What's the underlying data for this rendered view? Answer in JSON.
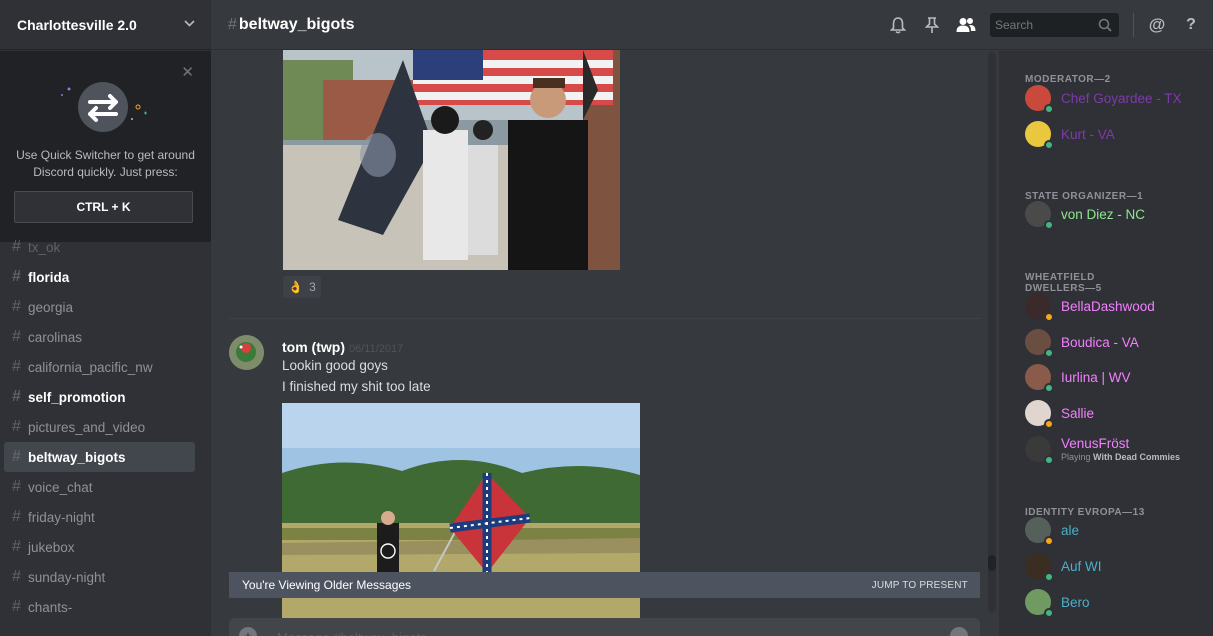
{
  "server": {
    "name": "Charlottesville 2.0"
  },
  "quick_switcher": {
    "text": "Use Quick Switcher to get around Discord quickly. Just press:",
    "key": "CTRL + K"
  },
  "channels": [
    {
      "name": "tx_ok",
      "state": "muted"
    },
    {
      "name": "florida",
      "state": "unread"
    },
    {
      "name": "georgia",
      "state": "normal"
    },
    {
      "name": "carolinas",
      "state": "normal"
    },
    {
      "name": "california_pacific_nw",
      "state": "normal"
    },
    {
      "name": "self_promotion",
      "state": "unread"
    },
    {
      "name": "pictures_and_video",
      "state": "normal"
    },
    {
      "name": "beltway_bigots",
      "state": "active"
    },
    {
      "name": "voice_chat",
      "state": "normal"
    },
    {
      "name": "friday-night",
      "state": "normal"
    },
    {
      "name": "jukebox",
      "state": "normal"
    },
    {
      "name": "sunday-night",
      "state": "normal"
    },
    {
      "name": "chants-",
      "state": "normal"
    }
  ],
  "header": {
    "channel": "beltway_bigots",
    "search_placeholder": "Search",
    "at_symbol": "@",
    "help_symbol": "?"
  },
  "reaction": {
    "emoji": "👌",
    "count": "3"
  },
  "message": {
    "author": "tom (twp)",
    "timestamp": "06/11/2017",
    "lines": [
      "Lookin good goys",
      "I finished my shit too late"
    ]
  },
  "older_bar": {
    "text": "You're Viewing Older Messages",
    "jump": "JUMP TO PRESENT"
  },
  "composer": {
    "placeholder": "Message #beltway_bigots"
  },
  "colors": {
    "online": "#43b581",
    "idle": "#faa61a",
    "moderator": "#7e3aad",
    "organizer": "#8ee88e",
    "dweller": "#f47fff",
    "identity": "#4ab0c9"
  },
  "members": {
    "roles": [
      {
        "title": "MODERATOR—2",
        "color_key": "moderator",
        "members": [
          {
            "name": "Chef Goyardee - TX",
            "status": "online"
          },
          {
            "name": "Kurt - VA",
            "status": "online"
          }
        ]
      },
      {
        "title": "STATE ORGANIZER—1",
        "color_key": "organizer",
        "members": [
          {
            "name": "von Diez - NC",
            "status": "online"
          }
        ]
      },
      {
        "title": "WHEATFIELD DWELLERS—5",
        "color_key": "dweller",
        "members": [
          {
            "name": "BellaDashwood",
            "status": "idle"
          },
          {
            "name": "Boudica - VA",
            "status": "online"
          },
          {
            "name": "Iurlina | WV",
            "status": "online"
          },
          {
            "name": "Sallie",
            "status": "idle"
          },
          {
            "name": "VenusFröst",
            "status": "online",
            "playing_prefix": "Playing",
            "playing": "With Dead Commies"
          }
        ]
      },
      {
        "title": "IDENTITY EVROPA—13",
        "color_key": "identity",
        "members": [
          {
            "name": "ale",
            "status": "idle"
          },
          {
            "name": "Auf WI",
            "status": "online"
          },
          {
            "name": "Bero",
            "status": "online"
          }
        ]
      }
    ]
  }
}
